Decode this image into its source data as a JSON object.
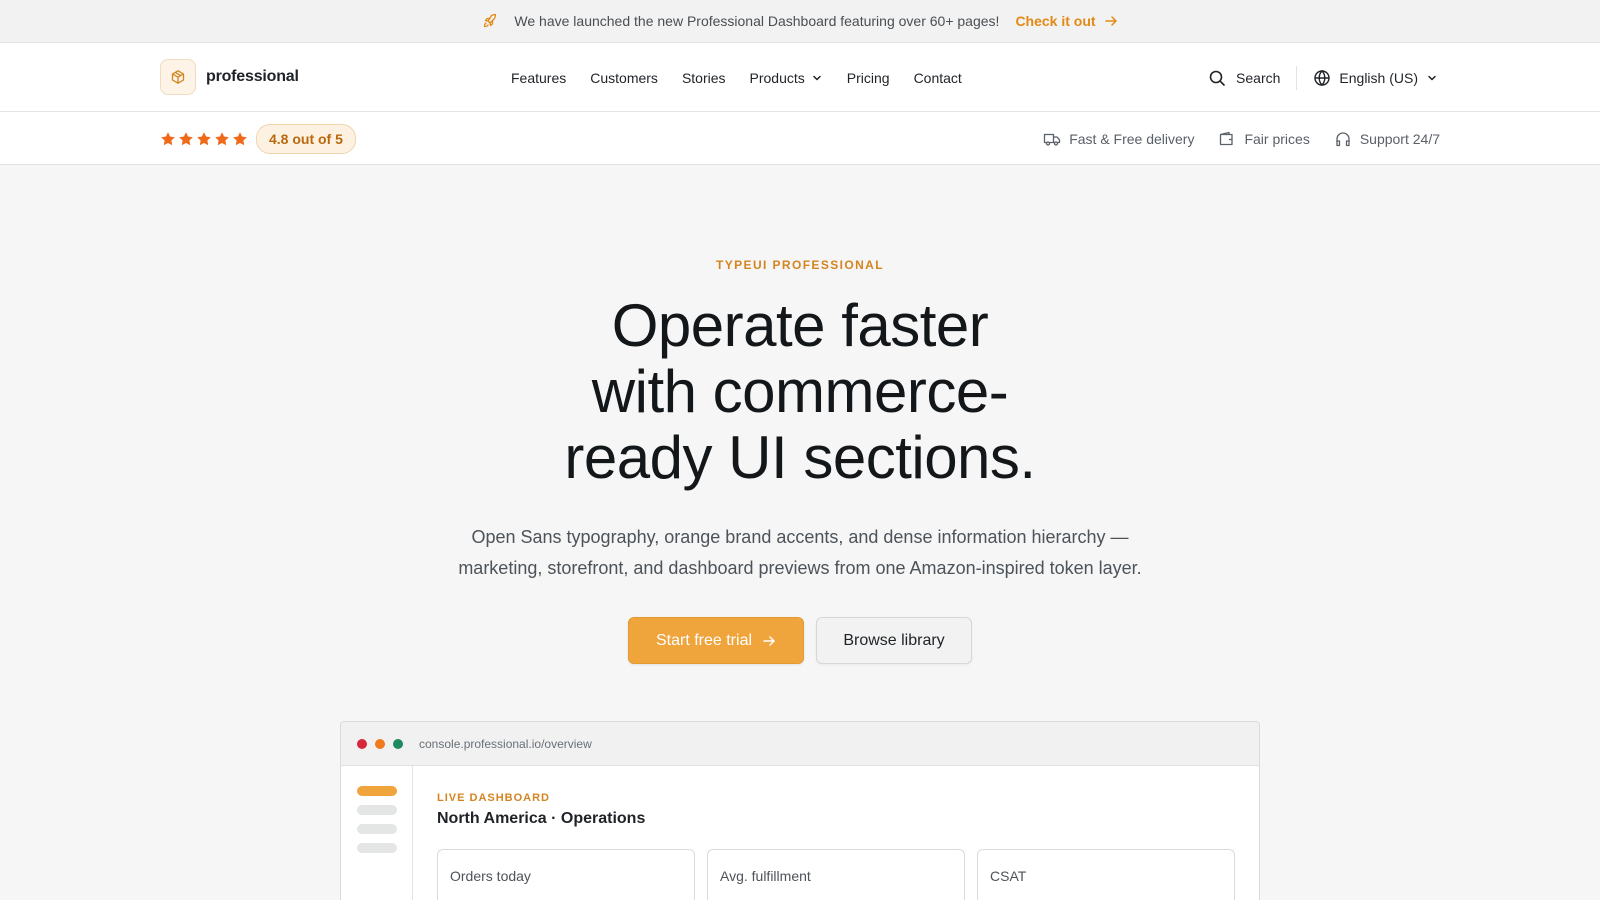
{
  "announcement": {
    "text": "We have launched the new Professional Dashboard featuring over 60+ pages!",
    "cta": "Check it out",
    "icon": "rocket-icon"
  },
  "nav": {
    "brand": "professional",
    "links": [
      "Features",
      "Customers",
      "Stories",
      "Products",
      "Pricing",
      "Contact"
    ],
    "search_label": "Search",
    "language": "English (US)"
  },
  "trust": {
    "rating_text": "4.8 out of 5",
    "stars": 5,
    "items": [
      "Fast & Free delivery",
      "Fair prices",
      "Support 24/7"
    ]
  },
  "hero": {
    "eyebrow": "TYPEUI PROFESSIONAL",
    "headline_lines": [
      "Operate faster",
      "with commerce-",
      "ready UI sections."
    ],
    "subhead_lines": [
      "Open Sans typography, orange brand accents, and dense information hierarchy —",
      "marketing, storefront, and dashboard previews from one Amazon-inspired token layer."
    ],
    "primary_cta": "Start free trial",
    "secondary_cta": "Browse library"
  },
  "preview": {
    "url": "console.professional.io/overview",
    "eyebrow": "LIVE DASHBOARD",
    "title": "North America · Operations",
    "kpis": [
      "Orders today",
      "Avg. fulfillment",
      "CSAT"
    ]
  },
  "colors": {
    "accent": "#f0a43c",
    "accent_text": "#d48421",
    "star": "#f06a1c",
    "dot_red": "#d6273b",
    "dot_orange": "#f07a1c",
    "dot_green": "#1f8a5b"
  }
}
